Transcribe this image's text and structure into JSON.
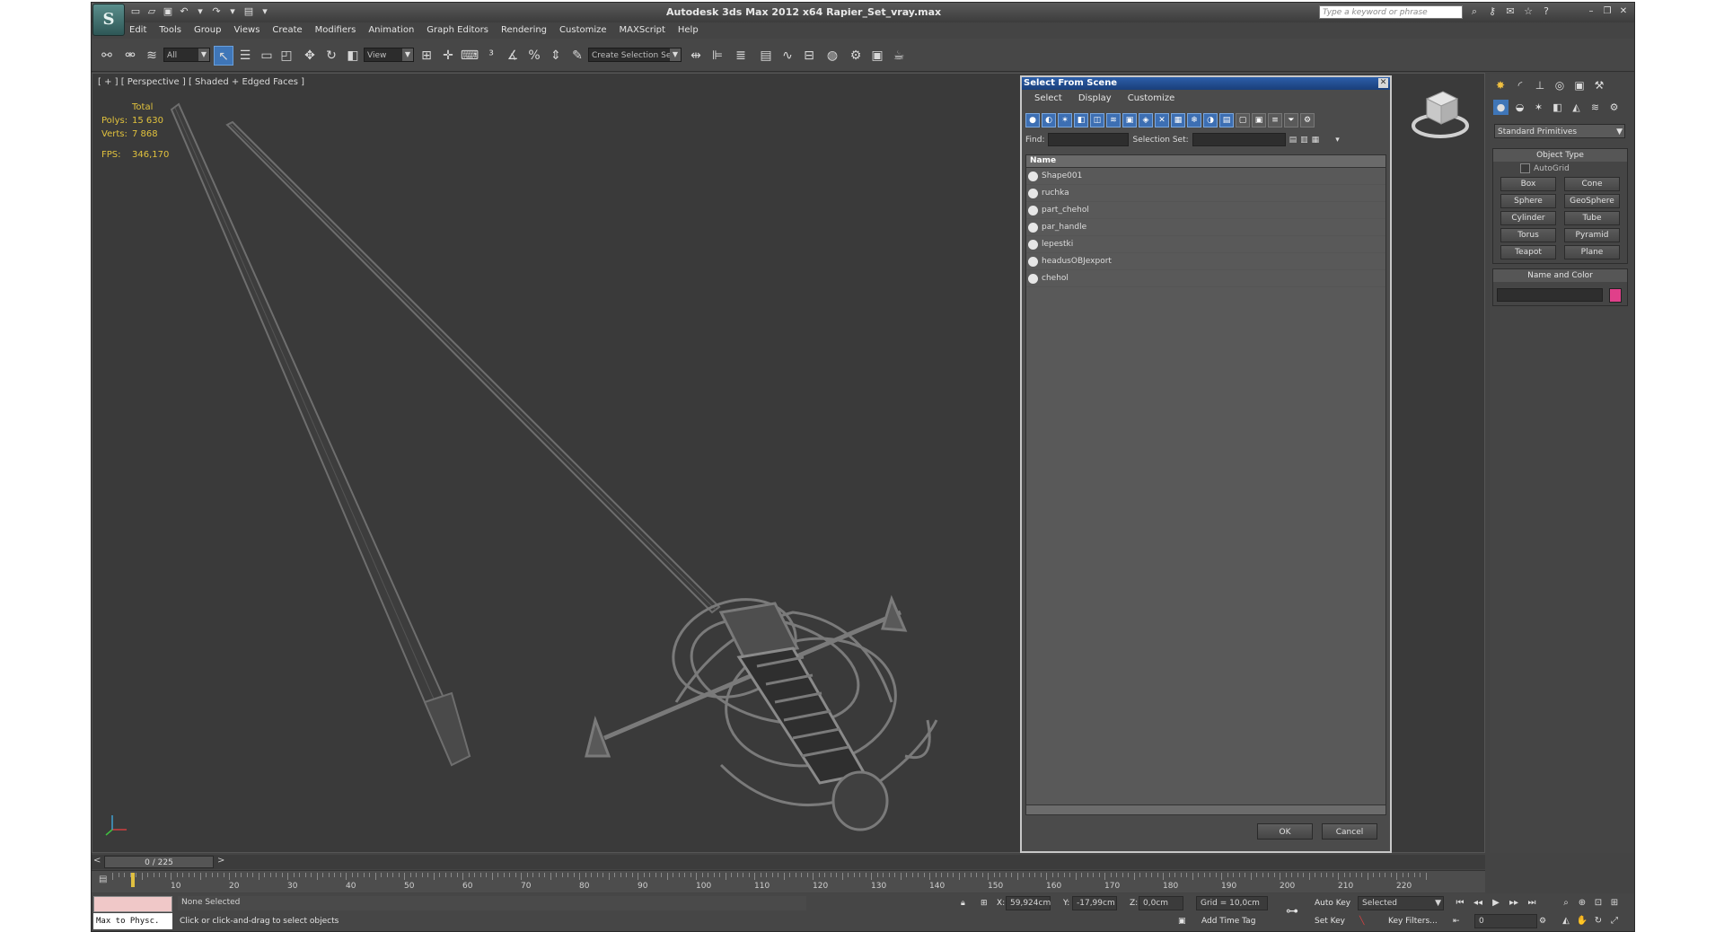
{
  "app": {
    "title": "Autodesk 3ds Max  2012 x64     Rapier_Set_vray.max",
    "logo": "3ds-max-logo",
    "search_placeholder": "Type a keyword or phrase"
  },
  "menu": [
    "Edit",
    "Tools",
    "Group",
    "Views",
    "Create",
    "Modifiers",
    "Animation",
    "Graph Editors",
    "Rendering",
    "Customize",
    "MAXScript",
    "Help"
  ],
  "toolbar": {
    "filter_value": "All",
    "refcoord_value": "View",
    "selection_set_value": "Create Selection Se"
  },
  "viewport": {
    "label": "[ + ] [ Perspective ] [ Shaded + Edged Faces ]",
    "stats": {
      "total_label": "Total",
      "polys_label": "Polys:",
      "polys_value": "15 630",
      "verts_label": "Verts:",
      "verts_value": "7 868",
      "fps_label": "FPS:",
      "fps_value": "346,170"
    }
  },
  "dialog": {
    "title": "Select From Scene",
    "menu": [
      "Select",
      "Display",
      "Customize"
    ],
    "find_label": "Find:",
    "selection_set_label": "Selection Set:",
    "column_name": "Name",
    "items": [
      "Shape001",
      "ruchka",
      "part_chehol",
      "par_handle",
      "lepestki",
      "headusOBJexport",
      "chehol"
    ],
    "ok_label": "OK",
    "cancel_label": "Cancel"
  },
  "command_panel": {
    "category": "Standard Primitives",
    "object_type_title": "Object Type",
    "autogrid_label": "AutoGrid",
    "buttons": [
      "Box",
      "Cone",
      "Sphere",
      "GeoSphere",
      "Cylinder",
      "Tube",
      "Torus",
      "Pyramid",
      "Teapot",
      "Plane"
    ],
    "name_color_title": "Name and Color",
    "object_color": "#e0408a"
  },
  "timeline": {
    "frame_display": "0 / 225",
    "ticks": [
      "10",
      "20",
      "30",
      "40",
      "50",
      "60",
      "70",
      "80",
      "90",
      "100",
      "110",
      "120",
      "130",
      "140",
      "150",
      "160",
      "170",
      "180",
      "190",
      "200",
      "210",
      "220"
    ]
  },
  "status": {
    "maxscript_listener": "Max to Physc.",
    "selection": "None Selected",
    "prompt": "Click or click-and-drag to select objects",
    "x_label": "X:",
    "x_value": "59,924cm",
    "y_label": "Y:",
    "y_value": "-17,99cm",
    "z_label": "Z:",
    "z_value": "0,0cm",
    "grid": "Grid = 10,0cm",
    "add_time_tag": "Add Time Tag",
    "auto_key": "Auto Key",
    "set_key": "Set Key",
    "selected_value": "Selected",
    "key_filters": "Key Filters...",
    "frame_value": "0"
  }
}
